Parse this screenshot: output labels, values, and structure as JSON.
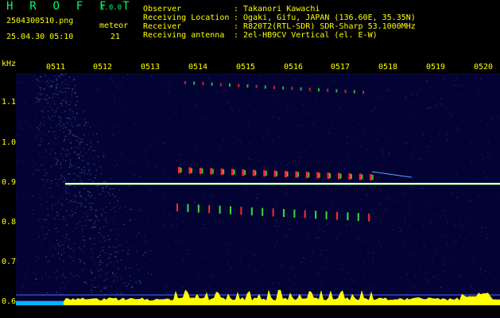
{
  "header": {
    "app_title": "H R O F F T",
    "app_version": "1.0.0",
    "file_name": "2504300510.png",
    "meteor_label": "meteor",
    "timestamp": "25.04.30 05:10",
    "meteor_count": "21"
  },
  "info": [
    {
      "key": "Observer",
      "value": ": Takanori Kawachi"
    },
    {
      "key": "Receiving Location",
      "value": ": Ogaki, Gifu, JAPAN (136.60E, 35.35N)"
    },
    {
      "key": "Receiver",
      "value": ": R820T2(RTL-SDR) SDR-Sharp 53.1000MHz"
    },
    {
      "key": "Receiving antenna",
      "value": ": 2el-HB9CV Vertical (el. E-W)"
    }
  ],
  "spectrogram": {
    "y_unit": "kHz",
    "y_ticks": [
      "1.1",
      "1.0",
      "0.9",
      "0.8",
      "0.7",
      "0.6"
    ],
    "x_ticks": [
      "0511",
      "0512",
      "0513",
      "0514",
      "0515",
      "0516",
      "0517",
      "0518",
      "0519",
      "0520"
    ],
    "carrier_khz": 0.9,
    "colors": {
      "background": "#030333",
      "noise": "#3a4cff",
      "carrier": "#ffffff",
      "signal_hot": "#ff2a2a",
      "signal_mid": "#38e038",
      "text": "#ffff00",
      "title": "#00ff66",
      "level_fill": "#ffff00",
      "level_low": "#00b4ff"
    }
  }
}
